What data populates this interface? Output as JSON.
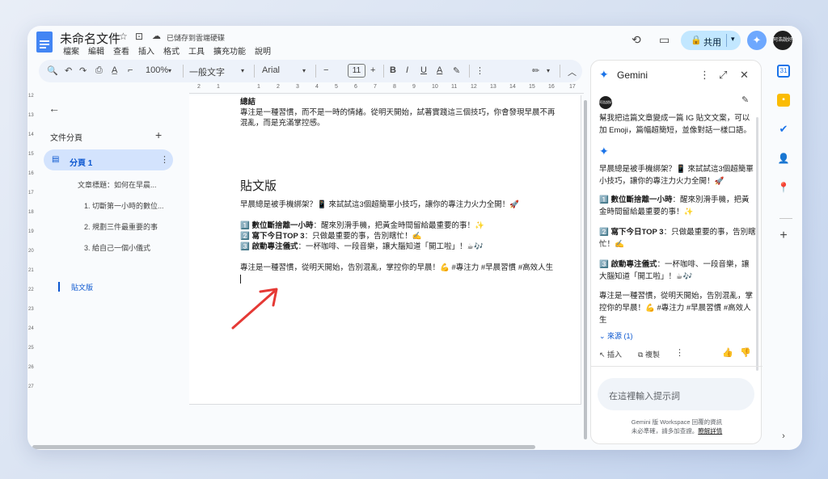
{
  "header": {
    "title": "未命名文件",
    "saved_status": "已儲存到雲端硬碟",
    "menu": [
      "檔案",
      "編輯",
      "查看",
      "插入",
      "格式",
      "工具",
      "擴充功能",
      "說明"
    ],
    "share_label": "共用",
    "avatar_text": "阿浩說好"
  },
  "toolbar": {
    "zoom": "100%",
    "style": "一般文字",
    "font": "Arial",
    "font_size": "11"
  },
  "ruler": {
    "h": [
      "2",
      "1",
      "1",
      "2",
      "3",
      "4",
      "5",
      "6",
      "7",
      "8",
      "9",
      "10",
      "11",
      "12",
      "13",
      "14",
      "15",
      "16",
      "17"
    ],
    "v": [
      "12",
      "13",
      "14",
      "15",
      "16",
      "17",
      "18",
      "19",
      "20",
      "21",
      "22",
      "23",
      "24",
      "25",
      "26",
      "27"
    ]
  },
  "sidebar": {
    "section_label": "文件分頁",
    "tab_label": "分頁 1",
    "outline": [
      "文章標題：如何在早晨...",
      "1. 切斷第一小時的數位...",
      "2. 規劃三件最重要的事",
      "3. 給自己一個小儀式",
      "貼文版"
    ]
  },
  "document": {
    "summary_heading": "總結",
    "summary_line1": "專注是一種習慣，而不是一時的情緒。從明天開始，試著實踐這三個技巧，你會發現早晨不再",
    "summary_line2": "混亂，而是充滿掌控感。",
    "post_heading": "貼文版",
    "intro": "早晨總是被手機綁架？📱 來試試這3個超簡單小技巧，讓你的專注力火力全開！🚀",
    "items": [
      {
        "num": "1️⃣",
        "title": "數位斷捨離一小時",
        "text": "：醒來別滑手機，把黃金時間留給最重要的事！✨"
      },
      {
        "num": "2️⃣",
        "title": "寫下今日TOP 3",
        "text": "：只做最重要的事，告別瞎忙！✍️"
      },
      {
        "num": "3️⃣",
        "title": "啟動專注儀式",
        "text": "：一杯咖啡、一段音樂，讓大腦知道「開工啦」！☕🎶"
      }
    ],
    "closing": "專注是一種習慣，從明天開始，告別混亂，掌控你的早晨！💪 #專注力 #早晨習慣 #高效人生"
  },
  "gemini": {
    "title": "Gemini",
    "prompt": "幫我把這篇文章變成一篇 IG 貼文文案，可以加 Emoji，篇幅超簡短，並像對話一樣口語。",
    "reply_intro": "早晨總是被手機綁架？📱 來試試這3個超簡單小技巧，讓你的專注力火力全開！🚀",
    "reply_items": [
      {
        "num": "1️⃣",
        "title": "數位斷捨離一小時",
        "text": "：醒來別滑手機，把黃金時間留給最重要的事！✨"
      },
      {
        "num": "2️⃣",
        "title": "寫下今日TOP 3",
        "text": "：只做最重要的事，告別瞎忙！✍️"
      },
      {
        "num": "3️⃣",
        "title": "啟動專注儀式",
        "text": "：一杯咖啡、一段音樂，讓大腦知道「開工啦」！☕🎶"
      }
    ],
    "reply_closing": "專注是一種習慣，從明天開始，告別混亂，掌控你的早晨！💪 #專注力 #早晨習慣 #高效人生",
    "sources": "來源 (1)",
    "insert": "插入",
    "copy": "複製",
    "input_placeholder": "在這裡輸入提示詞",
    "footer1": "Gemini 版 Workspace 回覆的資訊",
    "footer2": "未必準確，請多加查證。",
    "footer_link": "瞭解詳情"
  },
  "colors": {
    "accent": "#0b57d0",
    "share_bg": "#c2e7ff",
    "arrow": "#e53935",
    "gemini_star": "#1a73e8"
  }
}
